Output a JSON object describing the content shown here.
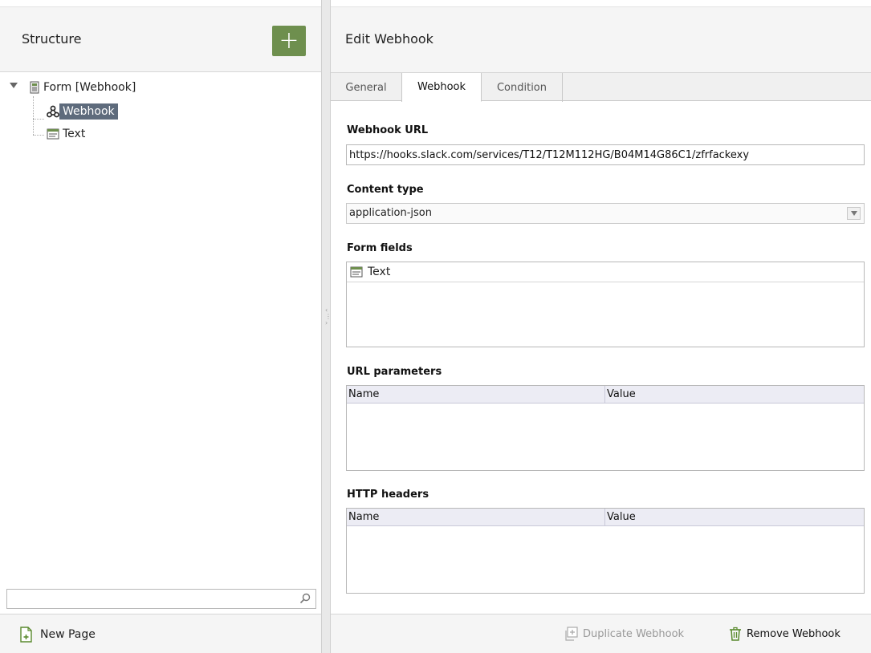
{
  "structure": {
    "title": "Structure",
    "add_button": "+",
    "tree": {
      "root_label": "Form [Webhook]",
      "children": [
        {
          "label": "Webhook",
          "selected": true
        },
        {
          "label": "Text",
          "selected": false
        }
      ]
    },
    "search": {
      "value": "",
      "placeholder": ""
    },
    "new_page_label": "New Page"
  },
  "editor": {
    "title": "Edit Webhook",
    "tabs": [
      {
        "label": "General",
        "active": false
      },
      {
        "label": "Webhook",
        "active": true
      },
      {
        "label": "Condition",
        "active": false
      }
    ],
    "webhook_url": {
      "label": "Webhook URL",
      "value": "https://hooks.slack.com/services/T12/T12M112HG/B04M14G86C1/zfrfackexy"
    },
    "content_type": {
      "label": "Content type",
      "value": "application-json"
    },
    "form_fields": {
      "label": "Form fields",
      "items": [
        "Text"
      ]
    },
    "url_parameters": {
      "label": "URL parameters",
      "columns": [
        "Name",
        "Value"
      ]
    },
    "http_headers": {
      "label": "HTTP headers",
      "columns": [
        "Name",
        "Value"
      ]
    },
    "footer": {
      "duplicate_label": "Duplicate Webhook",
      "remove_label": "Remove Webhook"
    }
  },
  "colors": {
    "add_button_bg": "#6e8f4e",
    "selection_bg": "#5e6b7c",
    "disabled_text": "#999999"
  }
}
